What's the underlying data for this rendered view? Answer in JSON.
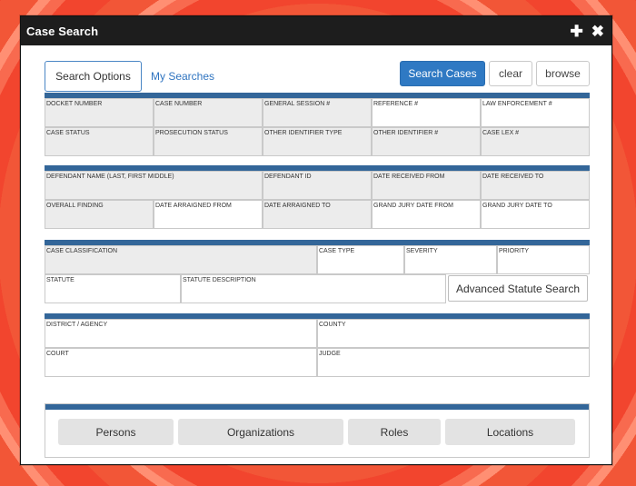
{
  "window": {
    "title": "Case Search",
    "add_icon": "plus-icon",
    "close_icon": "close-icon"
  },
  "tabs": {
    "search_options": "Search Options",
    "my_searches": "My Searches"
  },
  "actions": {
    "search_cases": "Search Cases",
    "clear": "clear",
    "browse": "browse"
  },
  "colors": {
    "accent": "#2f79c3",
    "section_bar": "#336699",
    "titlebar": "#1d1d1d",
    "field_bg": "#ececec"
  },
  "case_fields": {
    "docket_number": "DOCKET NUMBER",
    "case_number": "CASE NUMBER",
    "general_session": "GENERAL SESSION #",
    "reference": "REFERENCE #",
    "law_enforcement": "LAW ENFORCEMENT #",
    "case_status": "CASE STATUS",
    "prosecution_status": "PROSECUTION STATUS",
    "other_identifier_type": "OTHER IDENTIFIER TYPE",
    "other_identifier": "OTHER IDENTIFIER #",
    "case_lex": "CASE LEX #"
  },
  "defendant_fields": {
    "defendant_name": "DEFENDANT NAME (LAST, FIRST MIDDLE)",
    "defendant_id": "DEFENDANT ID",
    "date_received_from": "DATE RECEIVED FROM",
    "date_received_to": "DATE RECEIVED TO",
    "overall_finding": "OVERALL FINDING",
    "date_arraigned_from": "DATE ARRAIGNED FROM",
    "date_arraigned_to": "DATE ARRAIGNED TO",
    "grand_jury_from": "GRAND JURY DATE FROM",
    "grand_jury_to": "GRAND JURY DATE TO"
  },
  "classification_fields": {
    "case_classification": "CASE CLASSIFICATION",
    "case_type": "CASE TYPE",
    "severity": "SEVERITY",
    "priority": "PRIORITY",
    "statute": "STATUTE",
    "statute_description": "STATUTE DESCRIPTION",
    "advanced_statute_search": "Advanced Statute Search"
  },
  "location_fields": {
    "district_agency": "DISTRICT / AGENCY",
    "county": "COUNTY",
    "court": "COURT",
    "judge": "JUDGE"
  },
  "bottom_buttons": {
    "persons": "Persons",
    "organizations": "Organizations",
    "roles": "Roles",
    "locations": "Locations"
  }
}
